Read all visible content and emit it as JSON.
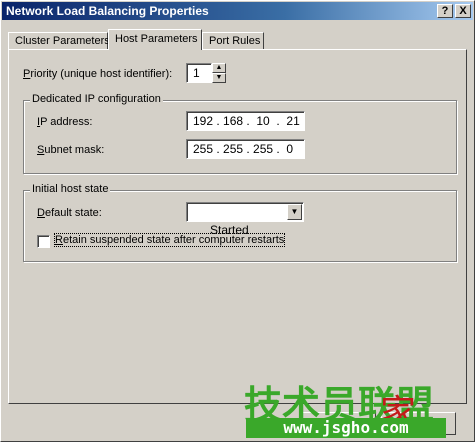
{
  "window": {
    "title": "Network Load Balancing Properties",
    "help": "?",
    "close": "X"
  },
  "tabs": [
    {
      "label": "Cluster Parameters"
    },
    {
      "label": "Host Parameters"
    },
    {
      "label": "Port Rules"
    }
  ],
  "priority": {
    "label_pre": "",
    "label_u": "P",
    "label_post": "riority (unique host identifier):",
    "value": "1"
  },
  "dedicated": {
    "title": "Dedicated IP configuration",
    "ip": {
      "label_u": "I",
      "label_post": "P address:",
      "value": "192 . 168 .  10  .  21"
    },
    "subnet": {
      "label_u": "S",
      "label_post": "ubnet mask:",
      "value": "255 . 255 . 255 .  0"
    }
  },
  "initial": {
    "title": "Initial host state",
    "default": {
      "label_u": "D",
      "label_post": "efault state:",
      "value": "Started"
    },
    "retain": {
      "label_u": "R",
      "label_post": "etain suspended state after computer restarts",
      "checked": false
    }
  },
  "watermark": {
    "text": "技术员联盟",
    "url": "www.jsgho.com",
    "mark": "家"
  },
  "colors": {
    "accent": "#0a246a",
    "watermark": "#3aa82a"
  }
}
